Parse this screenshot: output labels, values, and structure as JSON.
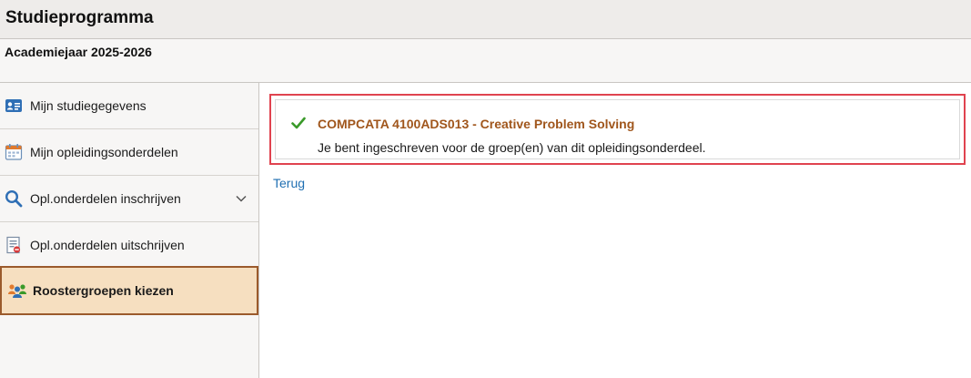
{
  "page": {
    "title": "Studieprogramma",
    "academic_year": "Academiejaar 2025-2026"
  },
  "sidebar": {
    "items": [
      {
        "label": "Mijn studiegegevens",
        "icon": "id-card-icon"
      },
      {
        "label": "Mijn opleidingsonderdelen",
        "icon": "calendar-icon"
      },
      {
        "label": "Opl.onderdelen inschrijven",
        "icon": "search-icon",
        "expandable": true
      },
      {
        "label": "Opl.onderdelen uitschrijven",
        "icon": "document-remove-icon"
      },
      {
        "label": "Roostergroepen kiezen",
        "icon": "people-icon",
        "active": true
      }
    ]
  },
  "message": {
    "status_icon": "checkmark-icon",
    "title": "COMPCATA 4100ADS013 - Creative Problem Solving",
    "text": "Je bent ingeschreven voor de groep(en) van dit opleidingsonderdeel."
  },
  "actions": {
    "back_label": "Terug"
  },
  "colors": {
    "accent": "#a0561c",
    "active_bg": "#f6dfc0",
    "active_border": "#9b5a2c",
    "highlight_border": "#e0434f",
    "link": "#1f6fb2",
    "check": "#3a9a2a"
  }
}
